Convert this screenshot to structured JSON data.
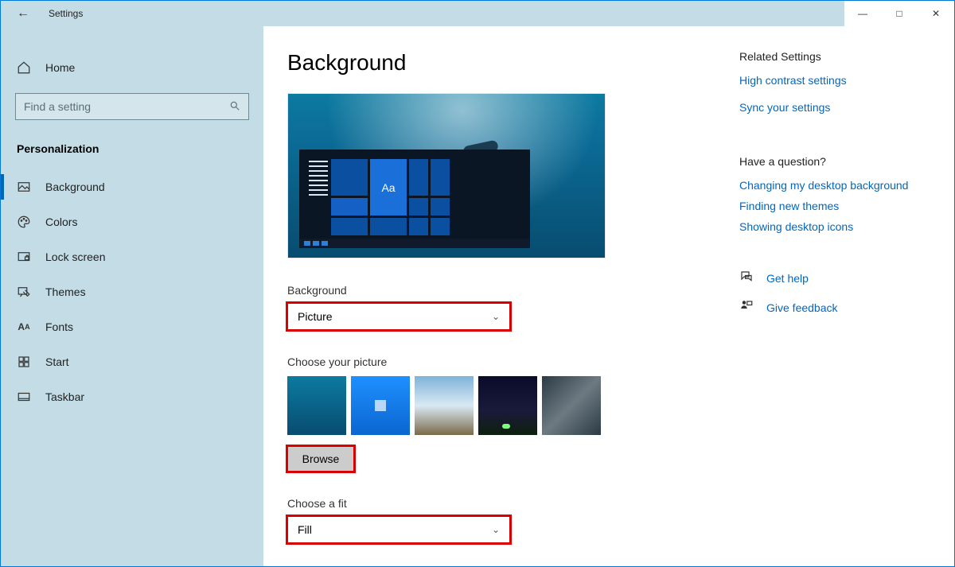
{
  "window": {
    "title": "Settings",
    "min_tooltip": "Minimize",
    "max_tooltip": "Maximize",
    "close_tooltip": "Close"
  },
  "sidebar": {
    "home": "Home",
    "search_placeholder": "Find a setting",
    "category": "Personalization",
    "items": [
      {
        "label": "Background",
        "active": true
      },
      {
        "label": "Colors"
      },
      {
        "label": "Lock screen"
      },
      {
        "label": "Themes"
      },
      {
        "label": "Fonts"
      },
      {
        "label": "Start"
      },
      {
        "label": "Taskbar"
      }
    ]
  },
  "main": {
    "title": "Background",
    "preview_tile_text": "Aa",
    "bg_label": "Background",
    "bg_value": "Picture",
    "choose_picture_label": "Choose your picture",
    "browse_label": "Browse",
    "fit_label": "Choose a fit",
    "fit_value": "Fill"
  },
  "right": {
    "related_head": "Related Settings",
    "high_contrast": "High contrast settings",
    "sync": "Sync your settings",
    "question_head": "Have a question?",
    "q1": "Changing my desktop background",
    "q2": "Finding new themes",
    "q3": "Showing desktop icons",
    "get_help": "Get help",
    "feedback": "Give feedback"
  }
}
